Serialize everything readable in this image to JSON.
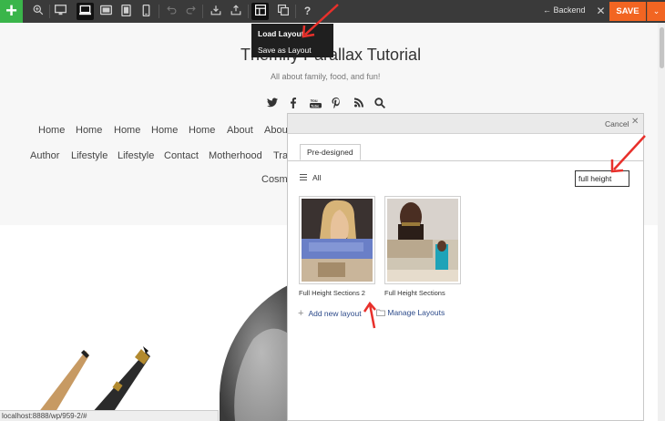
{
  "toolbar": {
    "backend_label": "Backend",
    "save_label": "SAVE",
    "accent": "#3ab54a",
    "save_color": "#f26522",
    "icons": [
      "plus-icon",
      "zoom-icon",
      "desktop-icon",
      "tablet-landscape-icon",
      "tablet-portrait-icon",
      "mobile-icon",
      "undo-icon",
      "redo-icon",
      "import-icon",
      "export-icon",
      "layout-icon",
      "duplicate-icon",
      "help-icon"
    ]
  },
  "layout_menu": {
    "items": [
      "Load Layout",
      "Save as Layout"
    ]
  },
  "site": {
    "title": "Themify Parallax Tutorial",
    "tagline": "All about family, food, and fun!",
    "nav_row1": [
      "Home",
      "Home",
      "Home",
      "Home",
      "Home",
      "About",
      "About"
    ],
    "nav_row2": [
      "Author",
      "Lifestyle",
      "Lifestyle",
      "Contact",
      "Motherhood",
      "Tra"
    ],
    "nav_row3": [
      "Cosme"
    ],
    "status_url": "localhost:8888/wp/959-2/#"
  },
  "lightbox": {
    "cancel_label": "Cancel",
    "tab_label": "Pre-designed",
    "category_label": "All",
    "search_value": "full height",
    "layouts": [
      {
        "label": "Full Height Sections 2"
      },
      {
        "label": "Full Height Sections"
      }
    ],
    "add_new_label": "Add new layout",
    "manage_label": "Manage Layouts"
  }
}
